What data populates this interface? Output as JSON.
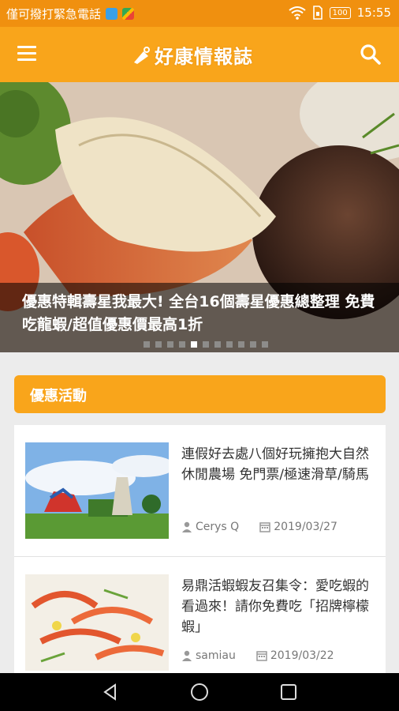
{
  "status_bar": {
    "carrier": "僅可撥打緊急電話",
    "battery": "100",
    "time": "15:55"
  },
  "app_bar": {
    "title": "好康情報誌",
    "menu_icon": "hamburger-menu-icon",
    "search_icon": "search-icon"
  },
  "hero": {
    "title": "優惠特輯壽星我最大! 全台16個壽星優惠總整理 免費吃龍蝦/超值優惠價最高1折",
    "page_count": 11,
    "active_index": 4
  },
  "section": {
    "title": "優惠活動"
  },
  "articles": [
    {
      "title": "連假好去處八個好玩擁抱大自然休閒農場 免門票/極速滑草/騎馬",
      "author": "Cerys Q",
      "date": "2019/03/27"
    },
    {
      "title": "易鼎活蝦蝦友召集令：愛吃蝦的看過來！請你免費吃「招牌檸檬蝦」",
      "author": "samiau",
      "date": "2019/03/22"
    }
  ],
  "colors": {
    "status": "#f0900f",
    "accent": "#f9a51b"
  }
}
